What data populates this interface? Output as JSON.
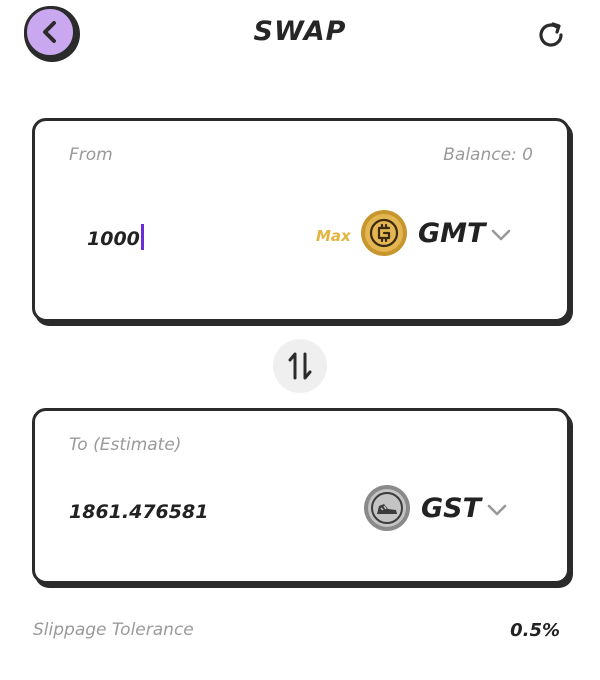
{
  "header": {
    "title": "SWAP",
    "back_icon": "chevron-left-icon",
    "refresh_icon": "refresh-icon"
  },
  "from": {
    "label": "From",
    "balance": "Balance: 0",
    "amount": "1000",
    "max_label": "Max",
    "token": "GMT",
    "token_icon": "gmt-coin-icon"
  },
  "to": {
    "label": "To (Estimate)",
    "amount": "1861.476581",
    "token": "GST",
    "token_icon": "gst-coin-icon"
  },
  "swap_icon": "swap-vertical-icon",
  "slippage": {
    "label": "Slippage Tolerance",
    "value": "0.5%"
  },
  "colors": {
    "back_button": "#c9a8f0",
    "max": "#e2b53e",
    "caret": "#6b2bd9",
    "gmt_coin": "#d9a93b",
    "gst_coin": "#bdbdbd"
  }
}
